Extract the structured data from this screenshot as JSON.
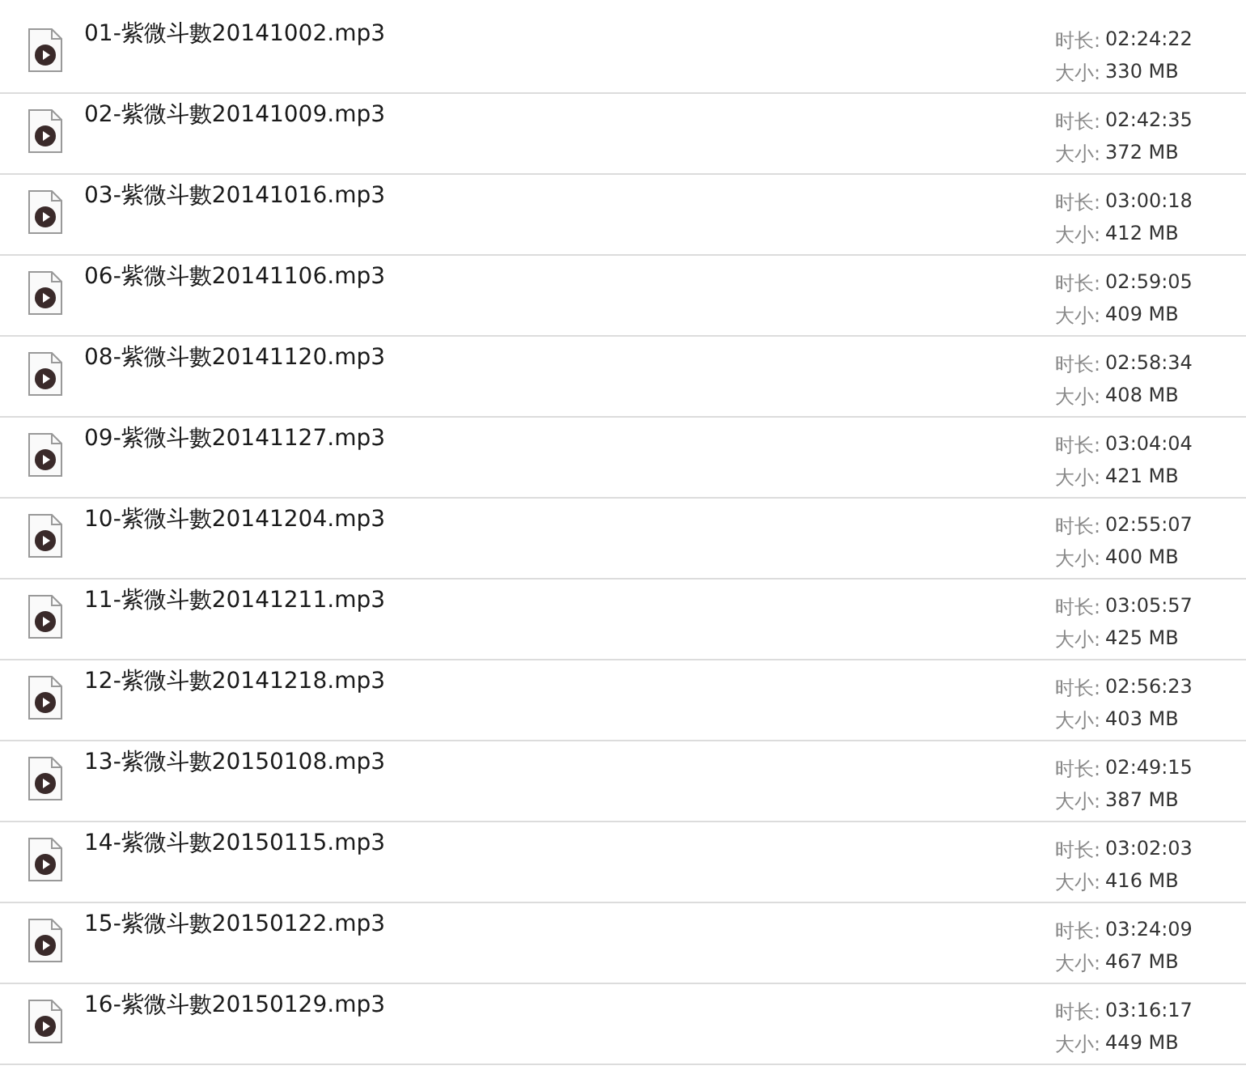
{
  "files": [
    {
      "name": "01-紫微斗數20141002.mp3",
      "duration_label": "时长:",
      "duration": "02:24:22",
      "size_label": "大小:",
      "size": "330 MB"
    },
    {
      "name": "02-紫微斗數20141009.mp3",
      "duration_label": "时长:",
      "duration": "02:42:35",
      "size_label": "大小:",
      "size": "372 MB"
    },
    {
      "name": "03-紫微斗數20141016.mp3",
      "duration_label": "时长:",
      "duration": "03:00:18",
      "size_label": "大小:",
      "size": "412 MB"
    },
    {
      "name": "06-紫微斗數20141106.mp3",
      "duration_label": "时长:",
      "duration": "02:59:05",
      "size_label": "大小:",
      "size": "409 MB"
    },
    {
      "name": "08-紫微斗數20141120.mp3",
      "duration_label": "时长:",
      "duration": "02:58:34",
      "size_label": "大小:",
      "size": "408 MB"
    },
    {
      "name": "09-紫微斗數20141127.mp3",
      "duration_label": "时长:",
      "duration": "03:04:04",
      "size_label": "大小:",
      "size": "421 MB"
    },
    {
      "name": "10-紫微斗數20141204.mp3",
      "duration_label": "时长:",
      "duration": "02:55:07",
      "size_label": "大小:",
      "size": "400 MB"
    },
    {
      "name": "11-紫微斗數20141211.mp3",
      "duration_label": "时长:",
      "duration": "03:05:57",
      "size_label": "大小:",
      "size": "425 MB"
    },
    {
      "name": "12-紫微斗數20141218.mp3",
      "duration_label": "时长:",
      "duration": "02:56:23",
      "size_label": "大小:",
      "size": "403 MB"
    },
    {
      "name": "13-紫微斗數20150108.mp3",
      "duration_label": "时长:",
      "duration": "02:49:15",
      "size_label": "大小:",
      "size": "387 MB"
    },
    {
      "name": "14-紫微斗數20150115.mp3",
      "duration_label": "时长:",
      "duration": "03:02:03",
      "size_label": "大小:",
      "size": "416 MB"
    },
    {
      "name": "15-紫微斗數20150122.mp3",
      "duration_label": "时长:",
      "duration": "03:24:09",
      "size_label": "大小:",
      "size": "467 MB"
    },
    {
      "name": "16-紫微斗數20150129.mp3",
      "duration_label": "时长:",
      "duration": "03:16:17",
      "size_label": "大小:",
      "size": "449 MB"
    }
  ]
}
